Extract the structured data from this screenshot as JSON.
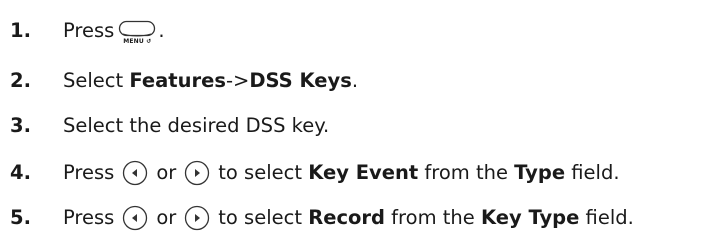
{
  "steps": [
    {
      "num": "1.",
      "press": "Press",
      "menu_key_label": "MENU ↺",
      "end": "."
    },
    {
      "num": "2.",
      "select": "Select ",
      "features": "Features",
      "arrow": "->",
      "dss_keys": "DSS Keys",
      "end": "."
    },
    {
      "num": "3.",
      "text": "Select the desired DSS key."
    },
    {
      "num": "4.",
      "press": "Press",
      "or": "or",
      "to_select": "to select ",
      "value": "Key Event",
      "from_the": " from the ",
      "field_name": "Type",
      "field": " field."
    },
    {
      "num": "5.",
      "press": "Press",
      "or": "or",
      "to_select": "to select ",
      "value": "Record",
      "from_the": " from the ",
      "field_name": "Key Type",
      "field": " field."
    }
  ],
  "icons": {
    "menu_key": "menu-key-icon",
    "left": "left-arrow-key-icon",
    "right": "right-arrow-key-icon"
  }
}
